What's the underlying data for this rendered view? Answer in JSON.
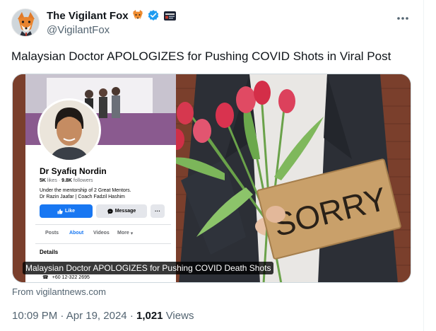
{
  "tweet": {
    "author": {
      "display_name": "The Vigilant Fox",
      "handle": "@VigilantFox",
      "badges": [
        "fox-emoji-icon",
        "verified-badge-icon",
        "affiliate-badge-icon"
      ]
    },
    "more_icon": "more-dots-icon",
    "text": "Malaysian Doctor APOLOGIZES for Pushing COVID Shots in Viral Post",
    "media": {
      "caption": "Malaysian Doctor APOLOGIZES for Pushing COVID Death Shots",
      "sign_text": "SORRY",
      "facebook_card": {
        "name": "Dr Syafiq Nordin",
        "likes": "5K",
        "likes_label": "likes",
        "followers": "9.8K",
        "followers_label": "followers",
        "bio_line1": "Under the mentorship of 2 Great Mentors.",
        "bio_line2": "Dr Razin Jaafar | Coach Fadzil Hashim",
        "like_button": "Like",
        "message_button": "Message",
        "dots_button": "···",
        "tabs": [
          "Posts",
          "About",
          "Videos",
          "More"
        ],
        "active_tab": "About",
        "details_heading": "Details",
        "phone": "+60 12-322 2695"
      }
    },
    "source": "From vigilantnews.com",
    "time": "10:09 PM",
    "date": "Apr 19, 2024",
    "separator": "·",
    "views_count": "1,021",
    "views_label": "Views"
  },
  "colors": {
    "text_primary": "#0f1419",
    "text_secondary": "#536471",
    "verified_blue": "#1d9bf0",
    "facebook_blue": "#1877f2",
    "tulip_red": "#d9334f",
    "cardboard": "#c9a06a"
  }
}
